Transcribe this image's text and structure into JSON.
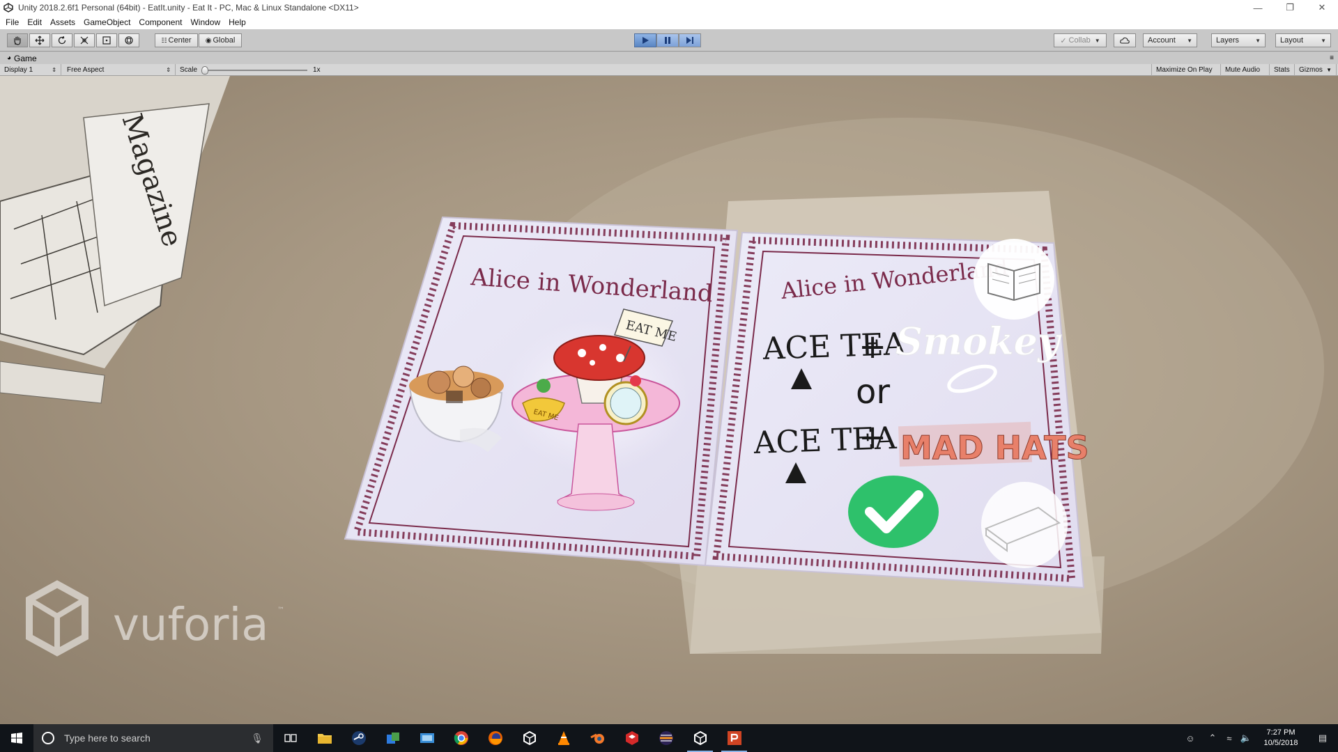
{
  "window": {
    "title": "Unity 2018.2.6f1 Personal (64bit) - EatIt.unity - Eat It - PC, Mac & Linux Standalone <DX11>"
  },
  "menu": [
    "File",
    "Edit",
    "Assets",
    "GameObject",
    "Component",
    "Window",
    "Help"
  ],
  "toolbar": {
    "pivot_label": "Center",
    "space_label": "Global",
    "collab_label": "Collab",
    "account_label": "Account",
    "layers_label": "Layers",
    "layout_label": "Layout"
  },
  "game_view": {
    "tab_label": "Game",
    "display_label": "Display 1",
    "aspect_label": "Free Aspect",
    "scale_label": "Scale",
    "scale_value": "1x",
    "maximize_label": "Maximize On Play",
    "mute_label": "Mute Audio",
    "stats_label": "Stats",
    "gizmos_label": "Gizmos"
  },
  "scene": {
    "left_card_title": "Alice in Wonderland",
    "right_card_title": "Alice in Wonderland",
    "eat_me_sign": "EAT ME",
    "cake_label": "EAT ME",
    "brand_1": "ACE TEA",
    "brand_2": "Smokey",
    "or_label": "or",
    "brand_3": "ACE TEA",
    "brand_4": "MAD HATS",
    "plus_label": "+",
    "watermark": "vuforia",
    "magazine_text": "Magazine"
  },
  "taskbar": {
    "search_placeholder": "Type here to search",
    "time": "7:27 PM",
    "date": "10/5/2018"
  },
  "colors": {
    "toolbar_bg": "#c8c8c8",
    "play_active": "#5a86c4",
    "card_border": "#7a2a4a",
    "check_green": "#2ec16b",
    "mad_hats": "#e8806a"
  }
}
